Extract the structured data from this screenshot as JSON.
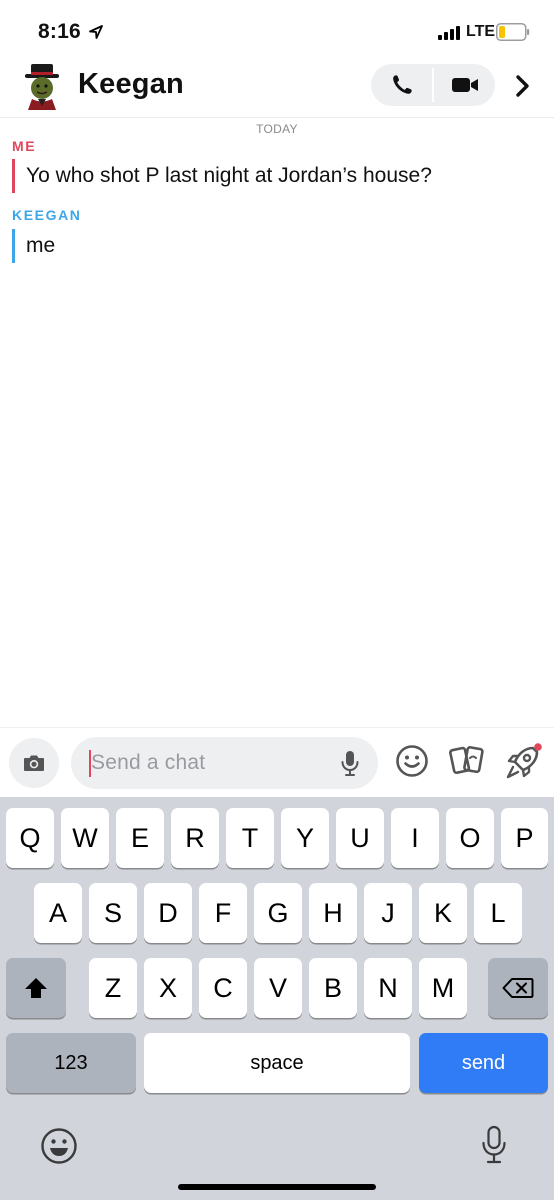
{
  "status_bar": {
    "time": "8:16",
    "network": "LTE"
  },
  "header": {
    "contact_name": "Keegan"
  },
  "conversation": {
    "day_label": "TODAY",
    "messages": [
      {
        "sender": "ME",
        "text": "Yo who shot P last night at Jordan’s house?",
        "color": "#e0475c"
      },
      {
        "sender": "KEEGAN",
        "text": "me",
        "color": "#3ea6e6"
      }
    ]
  },
  "input": {
    "placeholder": "Send a chat"
  },
  "keyboard": {
    "row1": [
      "Q",
      "W",
      "E",
      "R",
      "T",
      "Y",
      "U",
      "I",
      "O",
      "P"
    ],
    "row2": [
      "A",
      "S",
      "D",
      "F",
      "G",
      "H",
      "J",
      "K",
      "L"
    ],
    "row3": [
      "Z",
      "X",
      "C",
      "V",
      "B",
      "N",
      "M"
    ],
    "numbers_label": "123",
    "space_label": "space",
    "send_label": "send"
  },
  "icons": {
    "location": "location-arrow-icon",
    "signal": "cellular-signal-icon",
    "battery": "battery-low-icon",
    "phone": "phone-icon",
    "video": "video-camera-icon",
    "chevron": "chevron-right-icon",
    "camera": "camera-icon",
    "mic": "microphone-icon",
    "emoji": "smiley-icon",
    "cards": "cards-icon",
    "rocket": "rocket-icon"
  },
  "colors": {
    "me": "#e0475c",
    "keegan": "#3ea6e6",
    "send_key": "#2f7cf6",
    "battery_level": "#f5c400"
  }
}
